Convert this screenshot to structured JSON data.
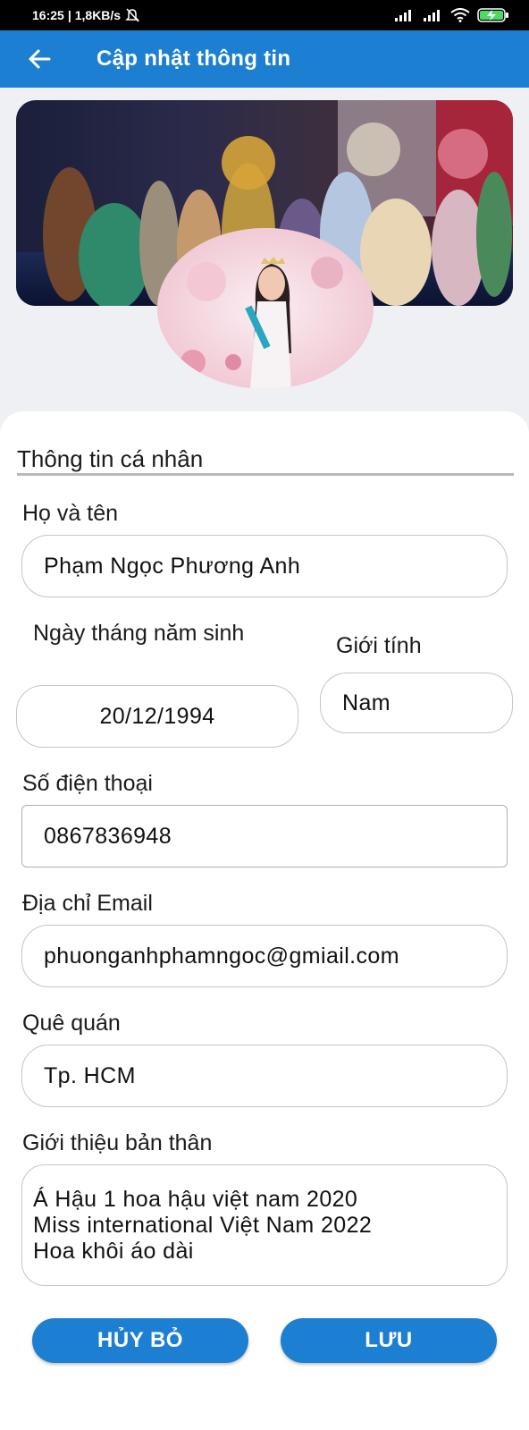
{
  "status_bar": {
    "time": "16:25",
    "speed": "1,8KB/s"
  },
  "header": {
    "title": "Cập nhật thông tin"
  },
  "profile": {
    "section_title": "Thông tin cá nhân",
    "fullname_label": "Họ và tên",
    "fullname_value": "Phạm Ngọc Phương Anh",
    "dob_label": "Ngày tháng năm sinh",
    "dob_value": "20/12/1994",
    "gender_label": "Giới tính",
    "gender_value": "Nam",
    "phone_label": "Số điện thoại",
    "phone_value": "0867836948",
    "email_label": "Địa chỉ Email",
    "email_value": "phuonganhphamngoc@gmiail.com",
    "hometown_label": "Quê quán",
    "hometown_value": "Tp. HCM",
    "bio_label": "Giới thiệu bản thân",
    "bio_lines": [
      "Á Hậu 1 hoa hậu việt nam 2020",
      "Miss international Việt Nam 2022",
      "Hoa khôi áo dài"
    ]
  },
  "actions": {
    "cancel": "HỦY BỎ",
    "save": "LƯU"
  }
}
